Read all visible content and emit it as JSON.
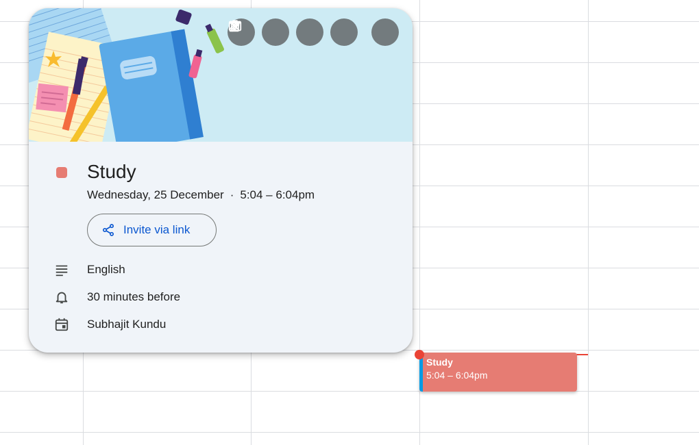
{
  "event": {
    "title": "Study",
    "date": "Wednesday, 25 December",
    "separator": "·",
    "time_range": "5:04 – 6:04pm",
    "color": "#e67c73"
  },
  "toolbar": {
    "edit_icon": "pencil-icon",
    "delete_icon": "trash-icon",
    "email_icon": "mail-icon",
    "more_icon": "more-vert-icon",
    "close_icon": "close-icon"
  },
  "invite": {
    "label": "Invite via link",
    "icon": "share-icon"
  },
  "details": [
    {
      "icon": "notes-icon",
      "text": "English"
    },
    {
      "icon": "bell-icon",
      "text": "30 minutes before"
    },
    {
      "icon": "calendar-icon",
      "text": "Subhajit Kundu"
    }
  ],
  "chip": {
    "title": "Study",
    "time": "5:04 – 6:04pm",
    "color": "#e67c73",
    "accent_color": "#039be5"
  },
  "now_indicator_color": "#ea4335"
}
